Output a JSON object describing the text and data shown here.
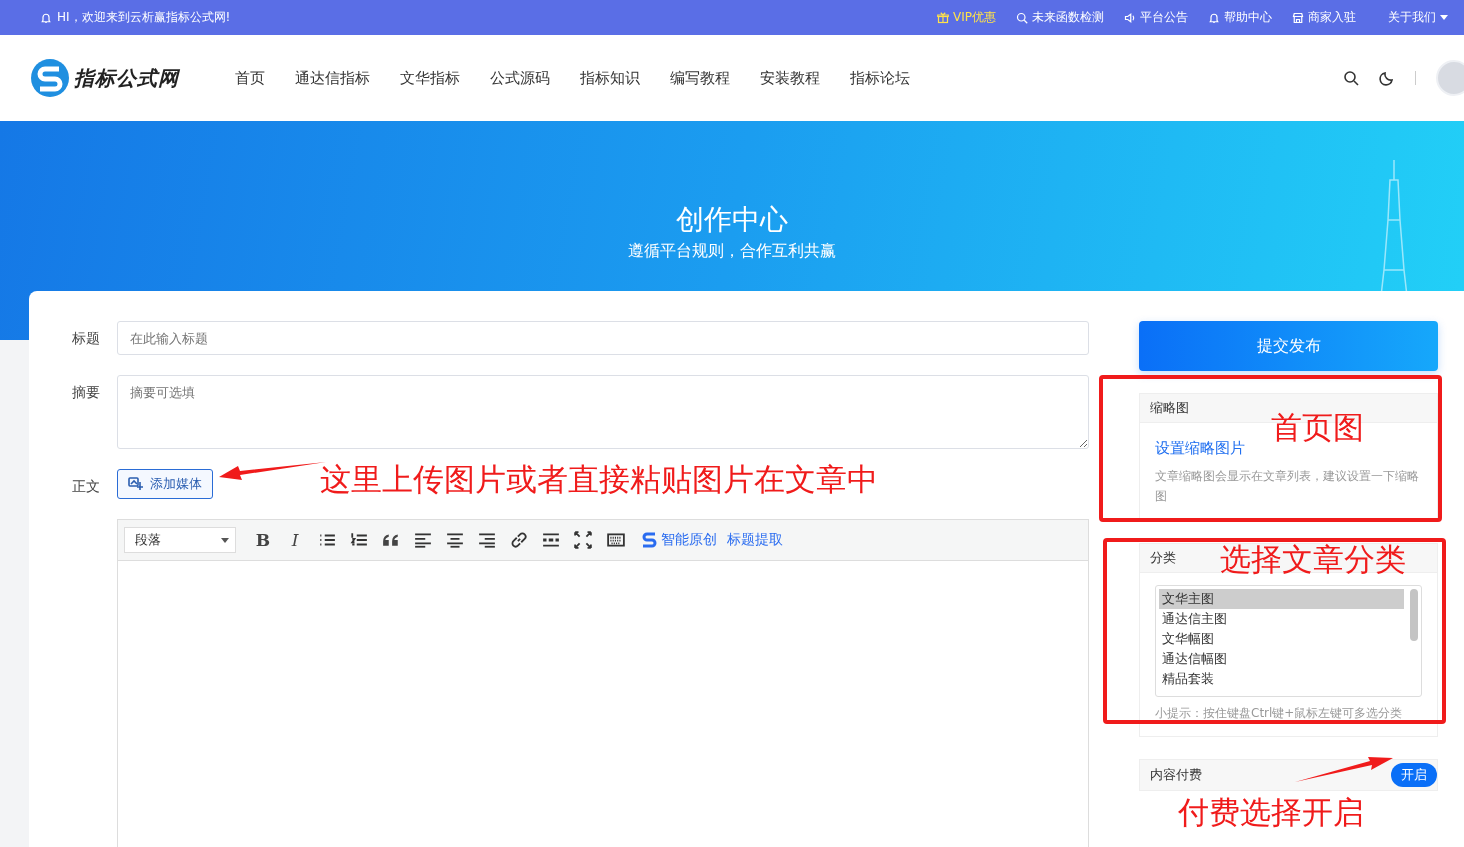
{
  "topbar": {
    "greeting": "HI，欢迎来到云析赢指标公式网!",
    "links": [
      {
        "label": "VIP优惠",
        "kind": "promo"
      },
      {
        "label": "未来函数检测",
        "kind": "link"
      },
      {
        "label": "平台公告",
        "kind": "link"
      },
      {
        "label": "帮助中心",
        "kind": "link"
      },
      {
        "label": "商家入驻",
        "kind": "link"
      },
      {
        "label": "关于我们",
        "kind": "dropdown"
      }
    ]
  },
  "nav": {
    "logo": "指标公式网",
    "items": [
      "首页",
      "通达信指标",
      "文华指标",
      "公式源码",
      "指标知识",
      "编写教程",
      "安装教程",
      "指标论坛"
    ]
  },
  "hero": {
    "title": "创作中心",
    "subtitle": "遵循平台规则，合作互利共赢"
  },
  "form": {
    "title_label": "标题",
    "title_placeholder": "在此输入标题",
    "summary_label": "摘要",
    "summary_placeholder": "摘要可选填",
    "body_label": "正文",
    "media_button": "添加媒体",
    "toolbar": [
      {
        "kind": "select",
        "label": "段落"
      },
      {
        "kind": "bold",
        "label": "B"
      },
      {
        "kind": "italic",
        "label": "I"
      },
      {
        "kind": "bullets"
      },
      {
        "kind": "numbers"
      },
      {
        "kind": "quote"
      },
      {
        "kind": "align-left"
      },
      {
        "kind": "align-center"
      },
      {
        "kind": "align-right"
      },
      {
        "kind": "link"
      },
      {
        "kind": "more"
      },
      {
        "kind": "fullscreen"
      },
      {
        "kind": "keyboard"
      },
      {
        "kind": "brand-link",
        "label": "智能原创"
      },
      {
        "kind": "text-link",
        "label": "标题提取"
      }
    ]
  },
  "sidebar": {
    "submit": "提交发布",
    "thumbnail": {
      "header": "缩略图",
      "link": "设置缩略图片",
      "hint": "文章缩略图会显示在文章列表，建议设置一下缩略图"
    },
    "category": {
      "header": "分类",
      "options": [
        {
          "label": "文华主图",
          "selected": true
        },
        {
          "label": "通达信主图",
          "selected": false
        },
        {
          "label": "文华幅图",
          "selected": false
        },
        {
          "label": "通达信幅图",
          "selected": false
        },
        {
          "label": "精品套装",
          "selected": false
        }
      ],
      "tip": "小提示：按住键盘Ctrl键+鼠标左键可多选分类"
    },
    "paid": {
      "label": "内容付费",
      "toggle": "开启",
      "on": true
    }
  },
  "annotations": [
    "这里上传图片或者直接粘贴图片在文章中",
    "首页图",
    "选择文章分类",
    "付费选择开启"
  ]
}
